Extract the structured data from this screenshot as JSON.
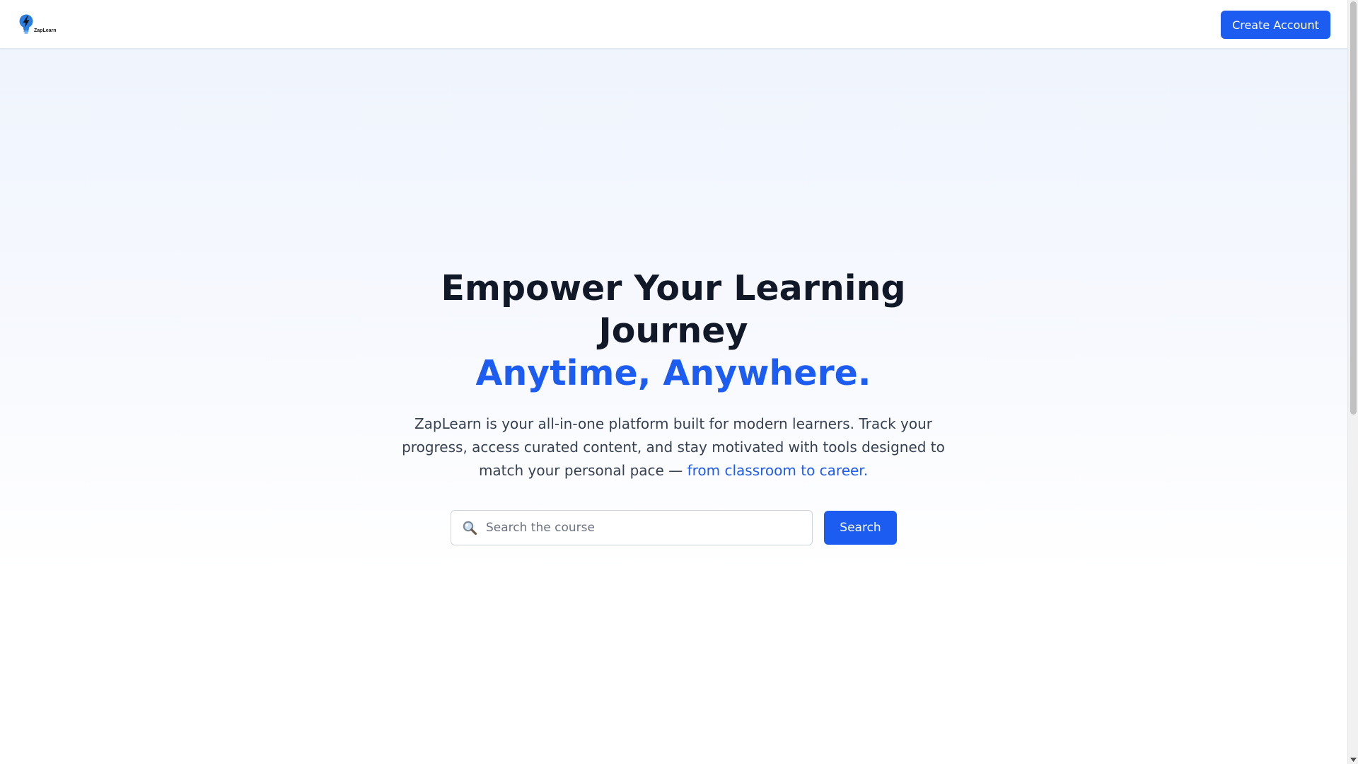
{
  "header": {
    "logo_text": "ZapLearn",
    "create_account_label": "Create Account"
  },
  "hero": {
    "title_line1": "Empower Your Learning Journey",
    "title_accent": "Anytime, Anywhere.",
    "subtitle_text": "ZapLearn is your all-in-one platform built for modern learners. Track your progress, access curated content, and stay motivated with tools designed to match your personal pace —",
    "subtitle_link": "from classroom to career."
  },
  "search": {
    "placeholder": "Search the course",
    "value": "",
    "button_label": "Search"
  },
  "icons": {
    "logo": "lightbulb-bolt-icon",
    "search": "magnifier-icon",
    "scroll_down": "scroll-down-arrow-icon"
  },
  "colors": {
    "accent": "#1d5cf0",
    "heading": "#111827",
    "body_text": "#374151"
  }
}
